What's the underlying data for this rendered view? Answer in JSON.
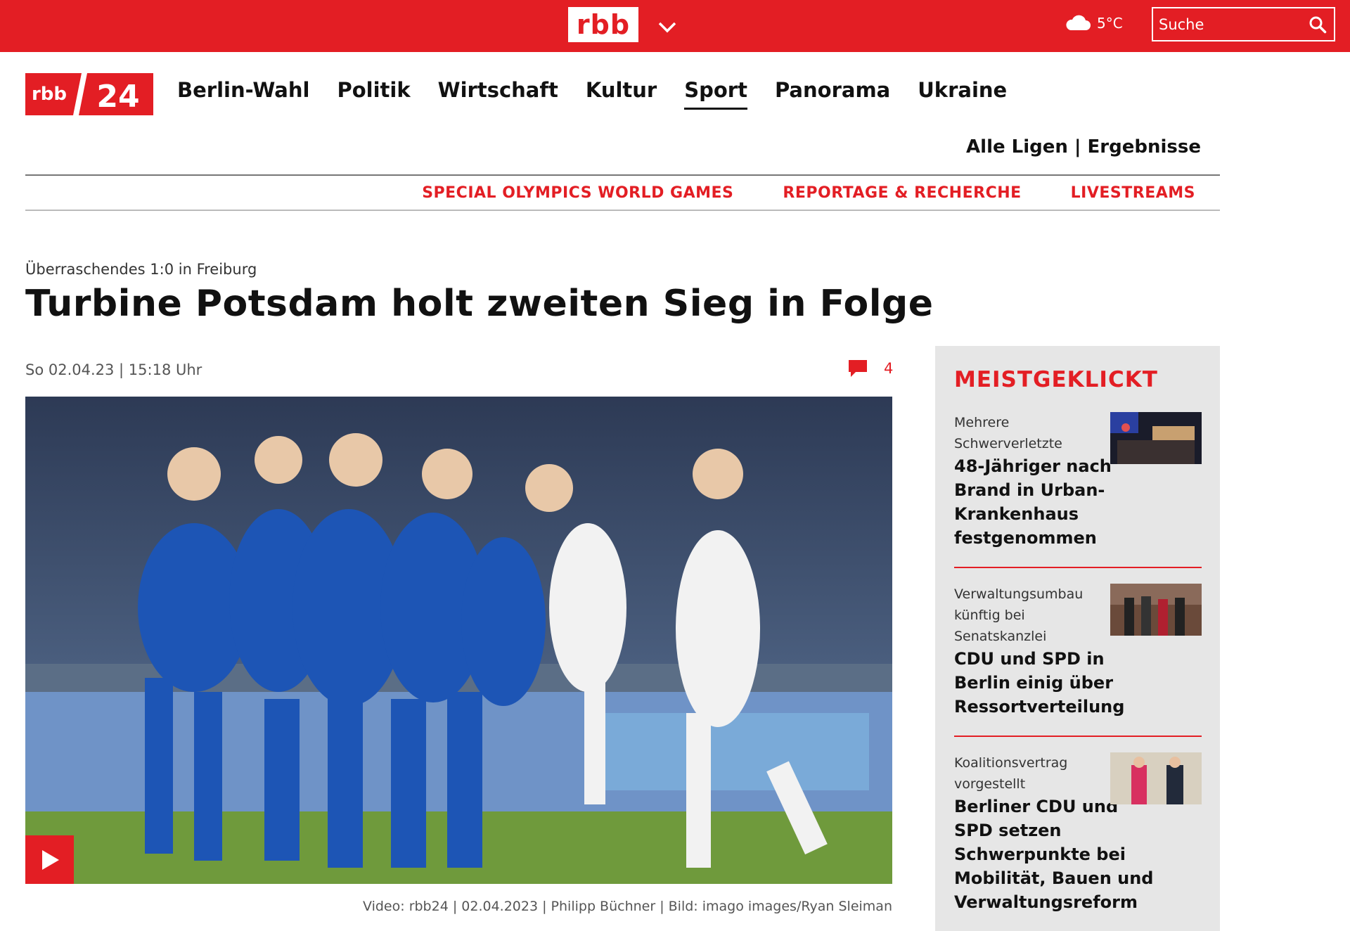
{
  "topbar": {
    "brand": "rbb",
    "weather_temp": "5°C",
    "search_placeholder": "Suche"
  },
  "logo": {
    "left": "rbb",
    "right": "24"
  },
  "nav": {
    "items": [
      {
        "label": "Berlin-Wahl",
        "active": false
      },
      {
        "label": "Politik",
        "active": false
      },
      {
        "label": "Wirtschaft",
        "active": false
      },
      {
        "label": "Kultur",
        "active": false
      },
      {
        "label": "Sport",
        "active": true
      },
      {
        "label": "Panorama",
        "active": false
      },
      {
        "label": "Ukraine",
        "active": false
      }
    ],
    "sub_links": {
      "leagues": "Alle Ligen",
      "separator": "|",
      "results": "Ergebnisse"
    },
    "specials": [
      "SPECIAL OLYMPICS WORLD GAMES",
      "REPORTAGE & RECHERCHE",
      "LIVESTREAMS"
    ]
  },
  "article": {
    "kicker": "Überraschendes 1:0 in Freiburg",
    "headline": "Turbine Potsdam holt zweiten Sieg in Folge",
    "dateline": "So 02.04.23 | 15:18 Uhr",
    "comment_count": "4",
    "caption": "Video: rbb24 | 02.04.2023 | Philipp Büchner | Bild: imago images/Ryan Sleiman"
  },
  "sidebar": {
    "title": "MEISTGEKLICKT",
    "teasers": [
      {
        "kicker": "Mehrere Schwerverletzte",
        "title": "48-Jähriger nach Brand in Urban-Krankenhaus festgenommen"
      },
      {
        "kicker": "Verwaltungsumbau künftig bei Senatskanzlei",
        "title": "CDU und SPD in Berlin einig über Ressortverteilung"
      },
      {
        "kicker": "Koalitionsvertrag vorgestellt",
        "title": "Berliner CDU und SPD setzen Schwerpunkte bei Mobilität, Bauen und Verwaltungsreform"
      }
    ]
  },
  "colors": {
    "brand_red": "#e31e24",
    "sidebar_bg": "#e6e6e6"
  }
}
